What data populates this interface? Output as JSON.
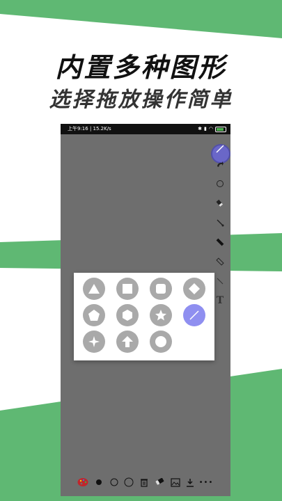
{
  "headline": {
    "line1": "内置多种图形",
    "line2": "选择拖放操作简单"
  },
  "colors": {
    "accent_green": "#5fb873",
    "canvas_gray": "#6e6e6e",
    "shape_gray": "#a9a9a9",
    "active_purple": "#8f8ff0"
  },
  "status_bar": {
    "left_text": "上午9:16 | 15.2K/s",
    "right_icons": [
      "bluetooth-icon",
      "signal-icon",
      "wifi-icon",
      "battery-icon"
    ]
  },
  "side_tools": [
    "line-tool-icon",
    "redo-icon",
    "circle-tool-icon",
    "eraser-icon",
    "brush-icon",
    "marker-icon",
    "pencil-icon",
    "fine-pen-icon",
    "text-icon"
  ],
  "text_tool_label": "T",
  "shape_panel": {
    "shapes": [
      "triangle",
      "square",
      "rounded-square",
      "diamond",
      "pentagon",
      "hexagon",
      "star",
      "line",
      "four-point-star",
      "arrow-up",
      "circle"
    ],
    "selected": "line"
  },
  "bottom_bar": {
    "items": [
      "palette-icon",
      "filled-dot-icon",
      "small-circle-icon",
      "large-circle-icon",
      "trash-icon",
      "eraser-icon",
      "gallery-icon",
      "download-icon",
      "more-icon"
    ],
    "more_label": "•••"
  }
}
